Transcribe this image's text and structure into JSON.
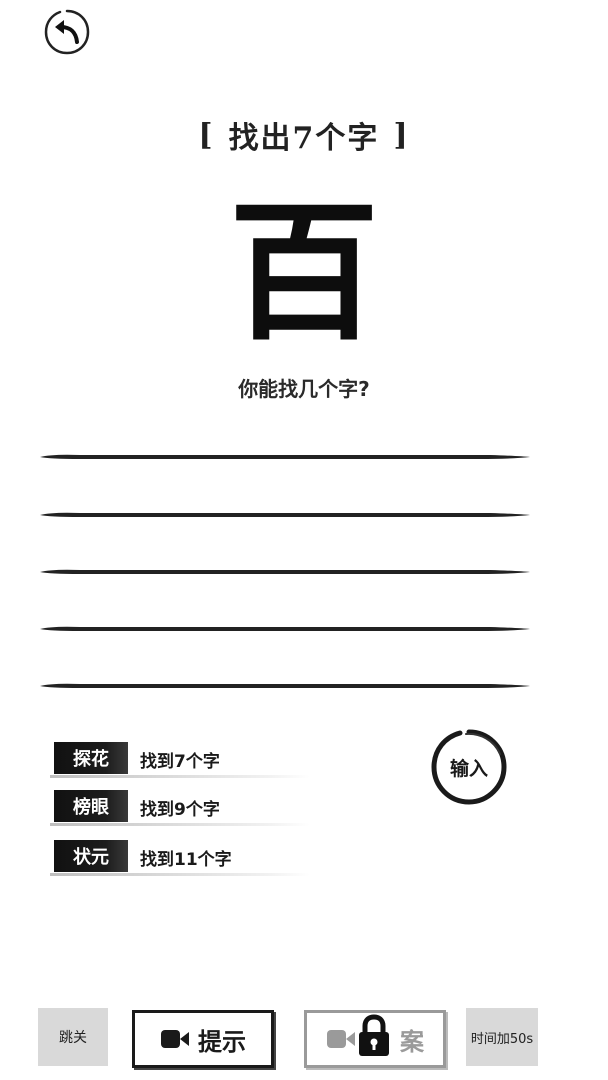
{
  "puzzle": {
    "title": "找出7个字",
    "bracket_left": "[",
    "bracket_right": "]",
    "character": "百",
    "question": "你能找几个字?"
  },
  "answer_slots": 5,
  "ranks": [
    {
      "badge": "探花",
      "text": "找到7个字"
    },
    {
      "badge": "榜眼",
      "text": "找到9个字"
    },
    {
      "badge": "状元",
      "text": "找到11个字"
    }
  ],
  "input_button": {
    "label": "输入"
  },
  "bottom_bar": {
    "skip_label": "跳关",
    "hint_label": "提示",
    "answer_label": "案",
    "time_label": "时间加50s"
  },
  "icons": {
    "back": "back-arrow-icon",
    "video_hint": "video-camera-icon",
    "video_answer": "video-camera-icon",
    "lock": "lock-icon"
  },
  "colors": {
    "ink": "#1a1a1a",
    "background": "#ffffff",
    "gray_button": "#d9d9d9",
    "disabled": "#9a9a9a"
  }
}
